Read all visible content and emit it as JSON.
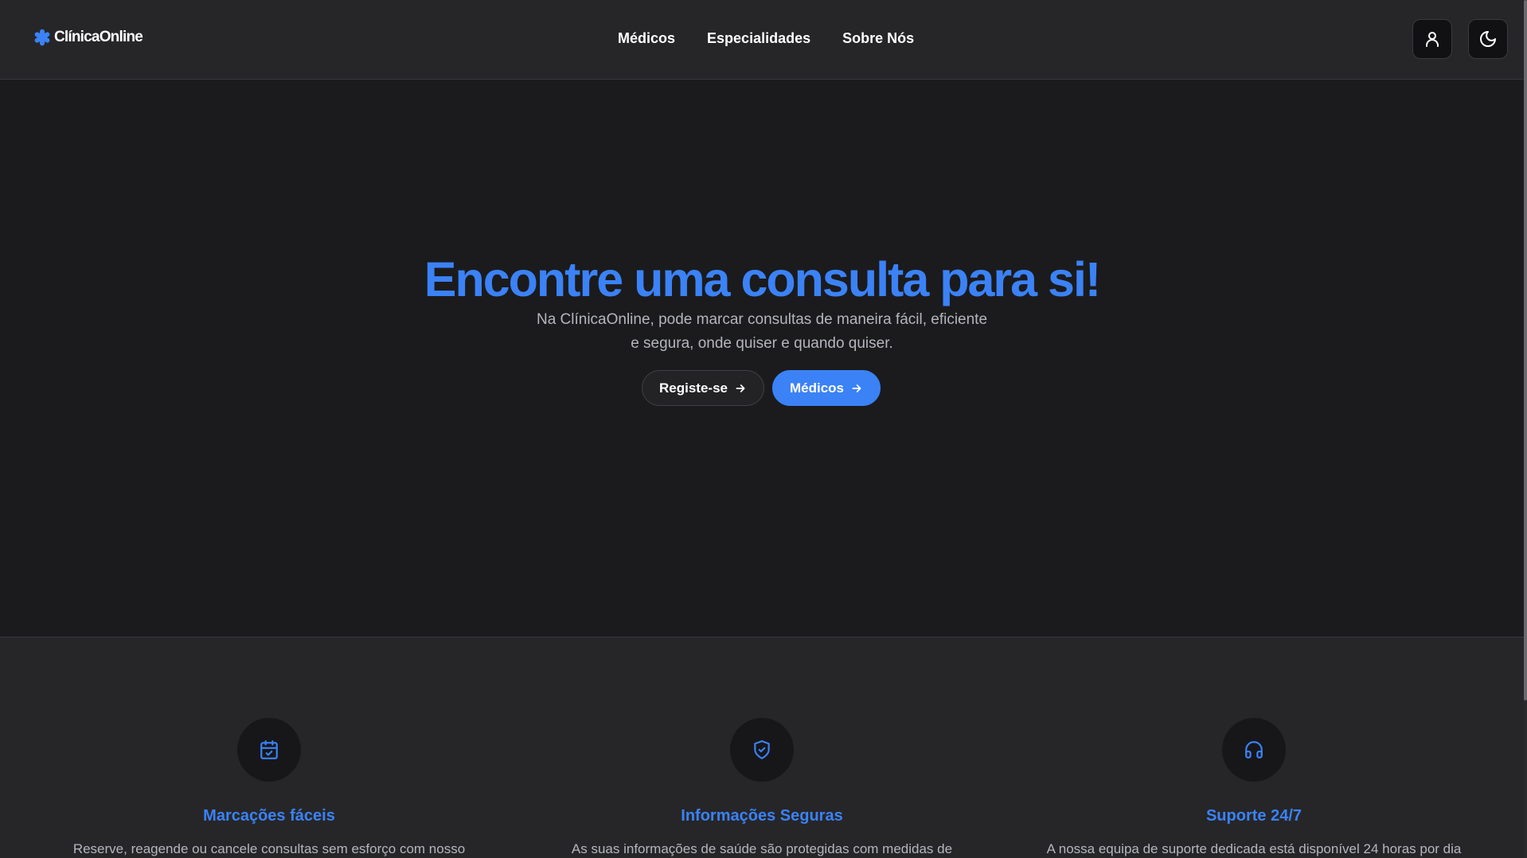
{
  "header": {
    "logo_text": "ClínicaOnline",
    "nav": [
      "Médicos",
      "Especialidades",
      "Sobre Nós"
    ],
    "user_icon": "user-icon",
    "theme_icon": "moon-icon"
  },
  "hero": {
    "title": "Encontre uma consulta para si!",
    "subtitle_line1": "Na ClínicaOnline, pode marcar consultas de maneira fácil, eficiente",
    "subtitle_line2": "e segura, onde quiser e quando quiser.",
    "register_label": "Registe-se",
    "doctors_label": "Médicos"
  },
  "features": [
    {
      "icon": "calendar-check-icon",
      "title": "Marcações fáceis",
      "text": "Reserve, reagende ou cancele consultas sem esforço com nosso"
    },
    {
      "icon": "shield-check-icon",
      "title": "Informações Seguras",
      "text": "As suas informações de saúde são protegidas com medidas de"
    },
    {
      "icon": "headphones-icon",
      "title": "Suporte 24/7",
      "text": "A nossa equipa de suporte dedicada está disponível 24 horas por dia"
    }
  ],
  "colors": {
    "accent": "#3b82f6",
    "background": "#1b1b1d",
    "surface": "#262629",
    "muted_text": "#b4b6bd"
  }
}
